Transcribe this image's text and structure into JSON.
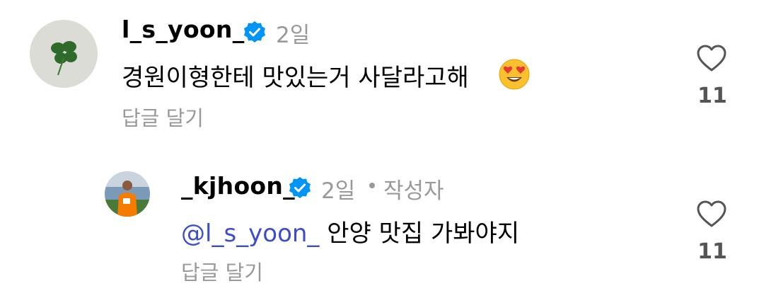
{
  "comments": [
    {
      "username": "l_s_yoon_",
      "time": "2일",
      "text": "경원이형한테 맛있는거 사달라고해",
      "emoji": "heart-eyes-emoji",
      "reply_label": "답글 달기",
      "likes": "11"
    },
    {
      "username": "_kjhoon_",
      "time": "2일",
      "author_badge": "작성자",
      "mention": "@l_s_yoon_",
      "text": "안양 맛집 가봐야지",
      "reply_label": "답글 달기",
      "likes": "11"
    }
  ],
  "colors": {
    "verified": "#0095f6",
    "mention": "#3e4cc9",
    "meta": "#999999"
  }
}
